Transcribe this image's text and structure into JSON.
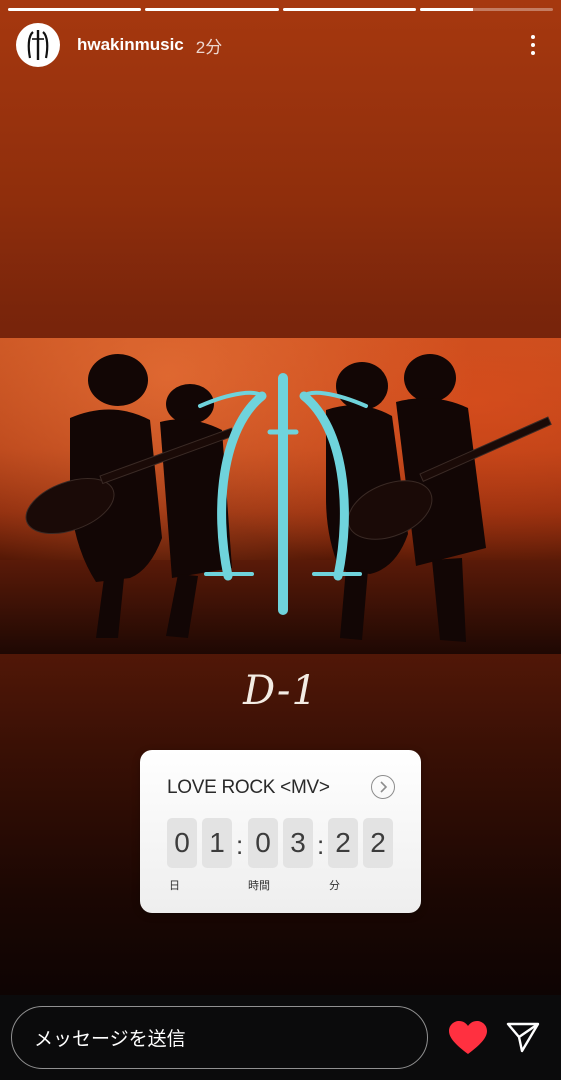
{
  "story": {
    "progress": [
      1,
      1,
      1,
      0.4
    ],
    "username": "hwakinmusic",
    "time": "2分",
    "title_text": "D-1"
  },
  "countdown": {
    "title": "LOVE ROCK <MV>",
    "digits": [
      "0",
      "1",
      "0",
      "3",
      "2",
      "2"
    ],
    "separator": ":",
    "units": [
      "日",
      "時間",
      "分"
    ]
  },
  "footer": {
    "message_placeholder": "メッセージを送信"
  },
  "colors": {
    "logo_cyan": "#6fd3dc",
    "heart_red": "#ff3040"
  },
  "icons": [
    "avatar-logo-icon",
    "more-options-icon",
    "chevron-right-icon",
    "heart-icon",
    "send-icon"
  ]
}
